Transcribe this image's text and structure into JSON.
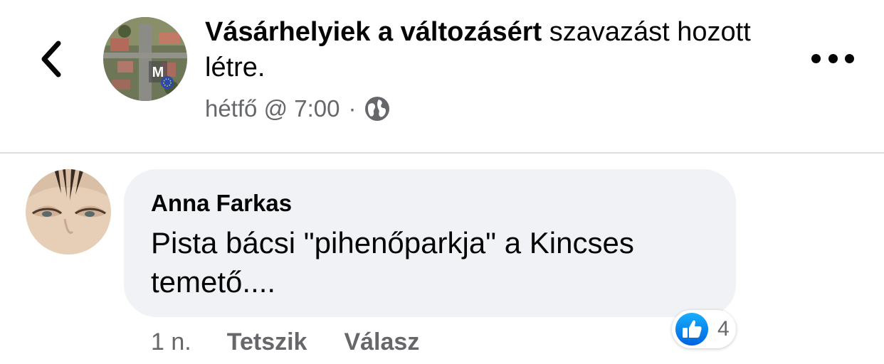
{
  "post_header": {
    "author": "Vásárhelyiek a változásért",
    "action": "szavazást hozott létre.",
    "timestamp": "hétfő @ 7:00",
    "separator": "·",
    "audience_icon": "globe-icon"
  },
  "icons": {
    "back": "chevron-left-icon",
    "more": "more-options-icon",
    "reaction": "like-icon"
  },
  "comment": {
    "author": "Anna Farkas",
    "text": "Pista bácsi \"pihenőparkja\" a Kincses temető....",
    "time": "1 n.",
    "like_label": "Tetszik",
    "reply_label": "Válasz",
    "reaction_count": "4"
  },
  "colors": {
    "bubble": "#f0f2f5",
    "secondary_text": "#65676b",
    "like_blue": "#1877f2"
  }
}
